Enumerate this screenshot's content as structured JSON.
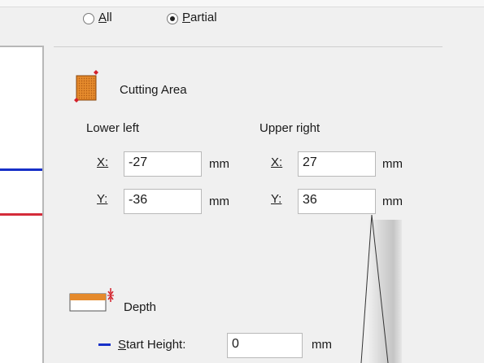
{
  "scope": {
    "all_label": "All",
    "all_mnemonic": "A",
    "all_rest": "ll",
    "partial_label": "Partial",
    "partial_mnemonic": "P",
    "partial_rest": "artial",
    "selected": "Partial"
  },
  "cutting_area": {
    "title": "Cutting Area",
    "lower_left": {
      "heading": "Lower left",
      "x_label": "X:",
      "x_value": "-27",
      "y_label": "Y:",
      "y_value": "-36",
      "unit": "mm"
    },
    "upper_right": {
      "heading": "Upper right",
      "x_label": "X:",
      "x_value": "27",
      "y_label": "Y:",
      "y_value": "36",
      "unit": "mm"
    }
  },
  "depth": {
    "title": "Depth",
    "start_height_label": "Start Height:",
    "start_height_mnemonic": "S",
    "start_height_rest": "tart Height:",
    "start_height_value": "0",
    "unit": "mm"
  },
  "colors": {
    "x_line": "#1730c8",
    "y_line": "#d42c3a",
    "icon_orange": "#e07a1c",
    "icon_red": "#d3202a"
  }
}
